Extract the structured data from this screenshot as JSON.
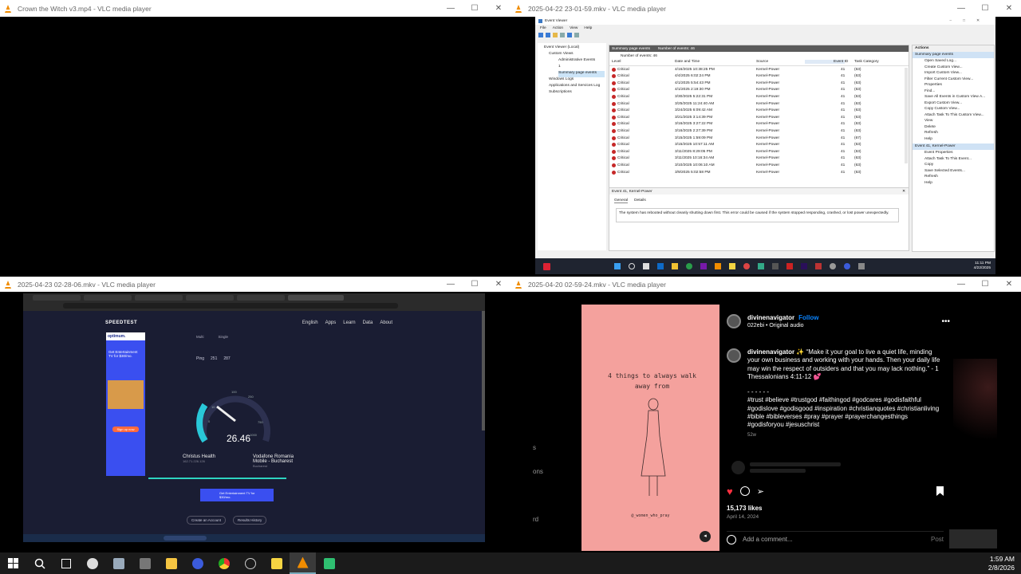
{
  "windows": {
    "w1": {
      "title": "Crown the Witch v3.mp4 - VLC media player"
    },
    "w2": {
      "title": "2025-04-22 23-01-59.mkv - VLC media player"
    },
    "w3": {
      "title": "2025-04-23 02-28-06.mkv - VLC media player"
    },
    "w4": {
      "title": "2025-04-20 02-59-24.mkv - VLC media player"
    }
  },
  "controls": {
    "minimize": "—",
    "maximize": "☐",
    "close": "✕"
  },
  "eventviewer": {
    "title": "Event Viewer",
    "menu": [
      "File",
      "Action",
      "View",
      "Help"
    ],
    "tree": [
      "Event Viewer (Local)",
      "Custom Views",
      "Administrative Events",
      "1",
      "Summary page events",
      "Windows Logs",
      "Applications and Services Log",
      "Subscriptions"
    ],
    "header": "Summary page events",
    "header_count": "Number of events: 46",
    "count": "Number of events: 46",
    "columns": [
      "Level",
      "Date and Time",
      "Source",
      "Event ID",
      "Task Category"
    ],
    "rows": [
      [
        "Critical",
        "4/16/2025 10:38:25 PM",
        "Kernel-Power",
        "41",
        "(63)"
      ],
      [
        "Critical",
        "4/4/2025 6:02:24 PM",
        "Kernel-Power",
        "41",
        "(63)"
      ],
      [
        "Critical",
        "4/1/2025 5:54:43 PM",
        "Kernel-Power",
        "41",
        "(63)"
      ],
      [
        "Critical",
        "4/1/2025 2:19:30 PM",
        "Kernel-Power",
        "41",
        "(63)"
      ],
      [
        "Critical",
        "3/30/2025 5:22:31 PM",
        "Kernel-Power",
        "41",
        "(63)"
      ],
      [
        "Critical",
        "3/25/2025 11:24:40 AM",
        "Kernel-Power",
        "41",
        "(63)"
      ],
      [
        "Critical",
        "3/24/2025 6:09:42 AM",
        "Kernel-Power",
        "41",
        "(63)"
      ],
      [
        "Critical",
        "3/21/2025 3:14:39 PM",
        "Kernel-Power",
        "41",
        "(63)"
      ],
      [
        "Critical",
        "3/16/2025 3:27:22 PM",
        "Kernel-Power",
        "41",
        "(63)"
      ],
      [
        "Critical",
        "3/16/2025 2:27:39 PM",
        "Kernel-Power",
        "41",
        "(63)"
      ],
      [
        "Critical",
        "3/15/2025 1:59:09 PM",
        "Kernel-Power",
        "41",
        "(67)"
      ],
      [
        "Critical",
        "3/15/2025 10:57:11 AM",
        "Kernel-Power",
        "41",
        "(63)"
      ],
      [
        "Critical",
        "3/11/2025 8:29:05 PM",
        "Kernel-Power",
        "41",
        "(63)"
      ],
      [
        "Critical",
        "3/11/2025 10:16:34 AM",
        "Kernel-Power",
        "41",
        "(63)"
      ],
      [
        "Critical",
        "3/10/2025 10:06:10 AM",
        "Kernel-Power",
        "41",
        "(63)"
      ],
      [
        "Critical",
        "3/9/2025 5:02:58 PM",
        "Kernel-Power",
        "41",
        "(63)"
      ]
    ],
    "detail_title": "Event 41, Kernel-Power",
    "detail_tabs": [
      "General",
      "Details"
    ],
    "detail_text": "The system has rebooted without cleanly shutting down first. This error could be caused if the system stopped responding, crashed, or lost power unexpectedly.",
    "actions_title": "Actions",
    "actions_section1": "Summary page events",
    "actions1": [
      "Open Saved Log...",
      "Create Custom View...",
      "Import Custom View...",
      "Filter Current Custom View...",
      "Properties",
      "Find...",
      "Save All Events in Custom View A...",
      "Export Custom View...",
      "Copy Custom View...",
      "Attach Task To This Custom View...",
      "View",
      "Delete",
      "Refresh",
      "Help"
    ],
    "actions_section2": "Event 41, Kernel-Power",
    "actions2": [
      "Event Properties",
      "Attach Task To This Event...",
      "Copy",
      "Save Selected Events...",
      "Refresh",
      "Help"
    ],
    "clock_time": "11:11 PM",
    "clock_date": "4/22/2025"
  },
  "speedtest": {
    "logo": "SPEEDTEST",
    "nav": [
      "English",
      "Apps",
      "Learn",
      "Data",
      "About"
    ],
    "ad_brand": "optimum.",
    "ad_text": "Get Entertainment TV for $30/mo.",
    "ad_btn": "Sign up now",
    "multi": "Multi",
    "single": "Single",
    "ping_label": "Ping",
    "ping_down": "251",
    "ping_up": "287",
    "gauge_ticks": [
      "0",
      "5",
      "10",
      "50",
      "100",
      "250",
      "500",
      "750",
      "1000"
    ],
    "speed": "26.46",
    "isp": "Christus Health",
    "isp_ip": "162.71.226.126",
    "server": "Vodafone Romania Mobile - Bucharest",
    "server_loc": "Bucharest",
    "create_account": "Create an Account",
    "results": "Results History",
    "banner_text": "Get Entertainment TV for $30/mo."
  },
  "instagram": {
    "card_title": "4 things to always walk away from",
    "card_handle": "@_women_who_pray",
    "user": "divinenavigator",
    "follow": "Follow",
    "audio": "022ebi • Original audio",
    "caption_user": "divinenavigator ✨",
    "caption": "“Make it your goal to live a quiet life, minding your own business and working with your hands. Then your daily life may win the respect of outsiders and that you may lack nothing.” - 1 Thessalonians 4:11-12 💕",
    "dashes": "- - - - - -",
    "tags": "#trust #believe #trustgod #faithingod #godcares #godisfaithful #godislove #godisgood #inspiration #christianquotes #christianliving #bible #bibleverses #pray #prayer #prayerchangesthings #godisforyou #jesuschrist",
    "age": "52w",
    "likes": "15,173 likes",
    "date": "April 14, 2024",
    "comment_placeholder": "Add a comment...",
    "post": "Post",
    "left_fragments": [
      "s",
      "ons",
      "rd"
    ]
  },
  "taskbar": {
    "time": "1:59 AM",
    "date": "2/8/2026"
  },
  "colors": {
    "accent": "#0a84ff",
    "like": "#ff3040",
    "pink": "#f4a19d",
    "vlc": "#f08c00"
  }
}
